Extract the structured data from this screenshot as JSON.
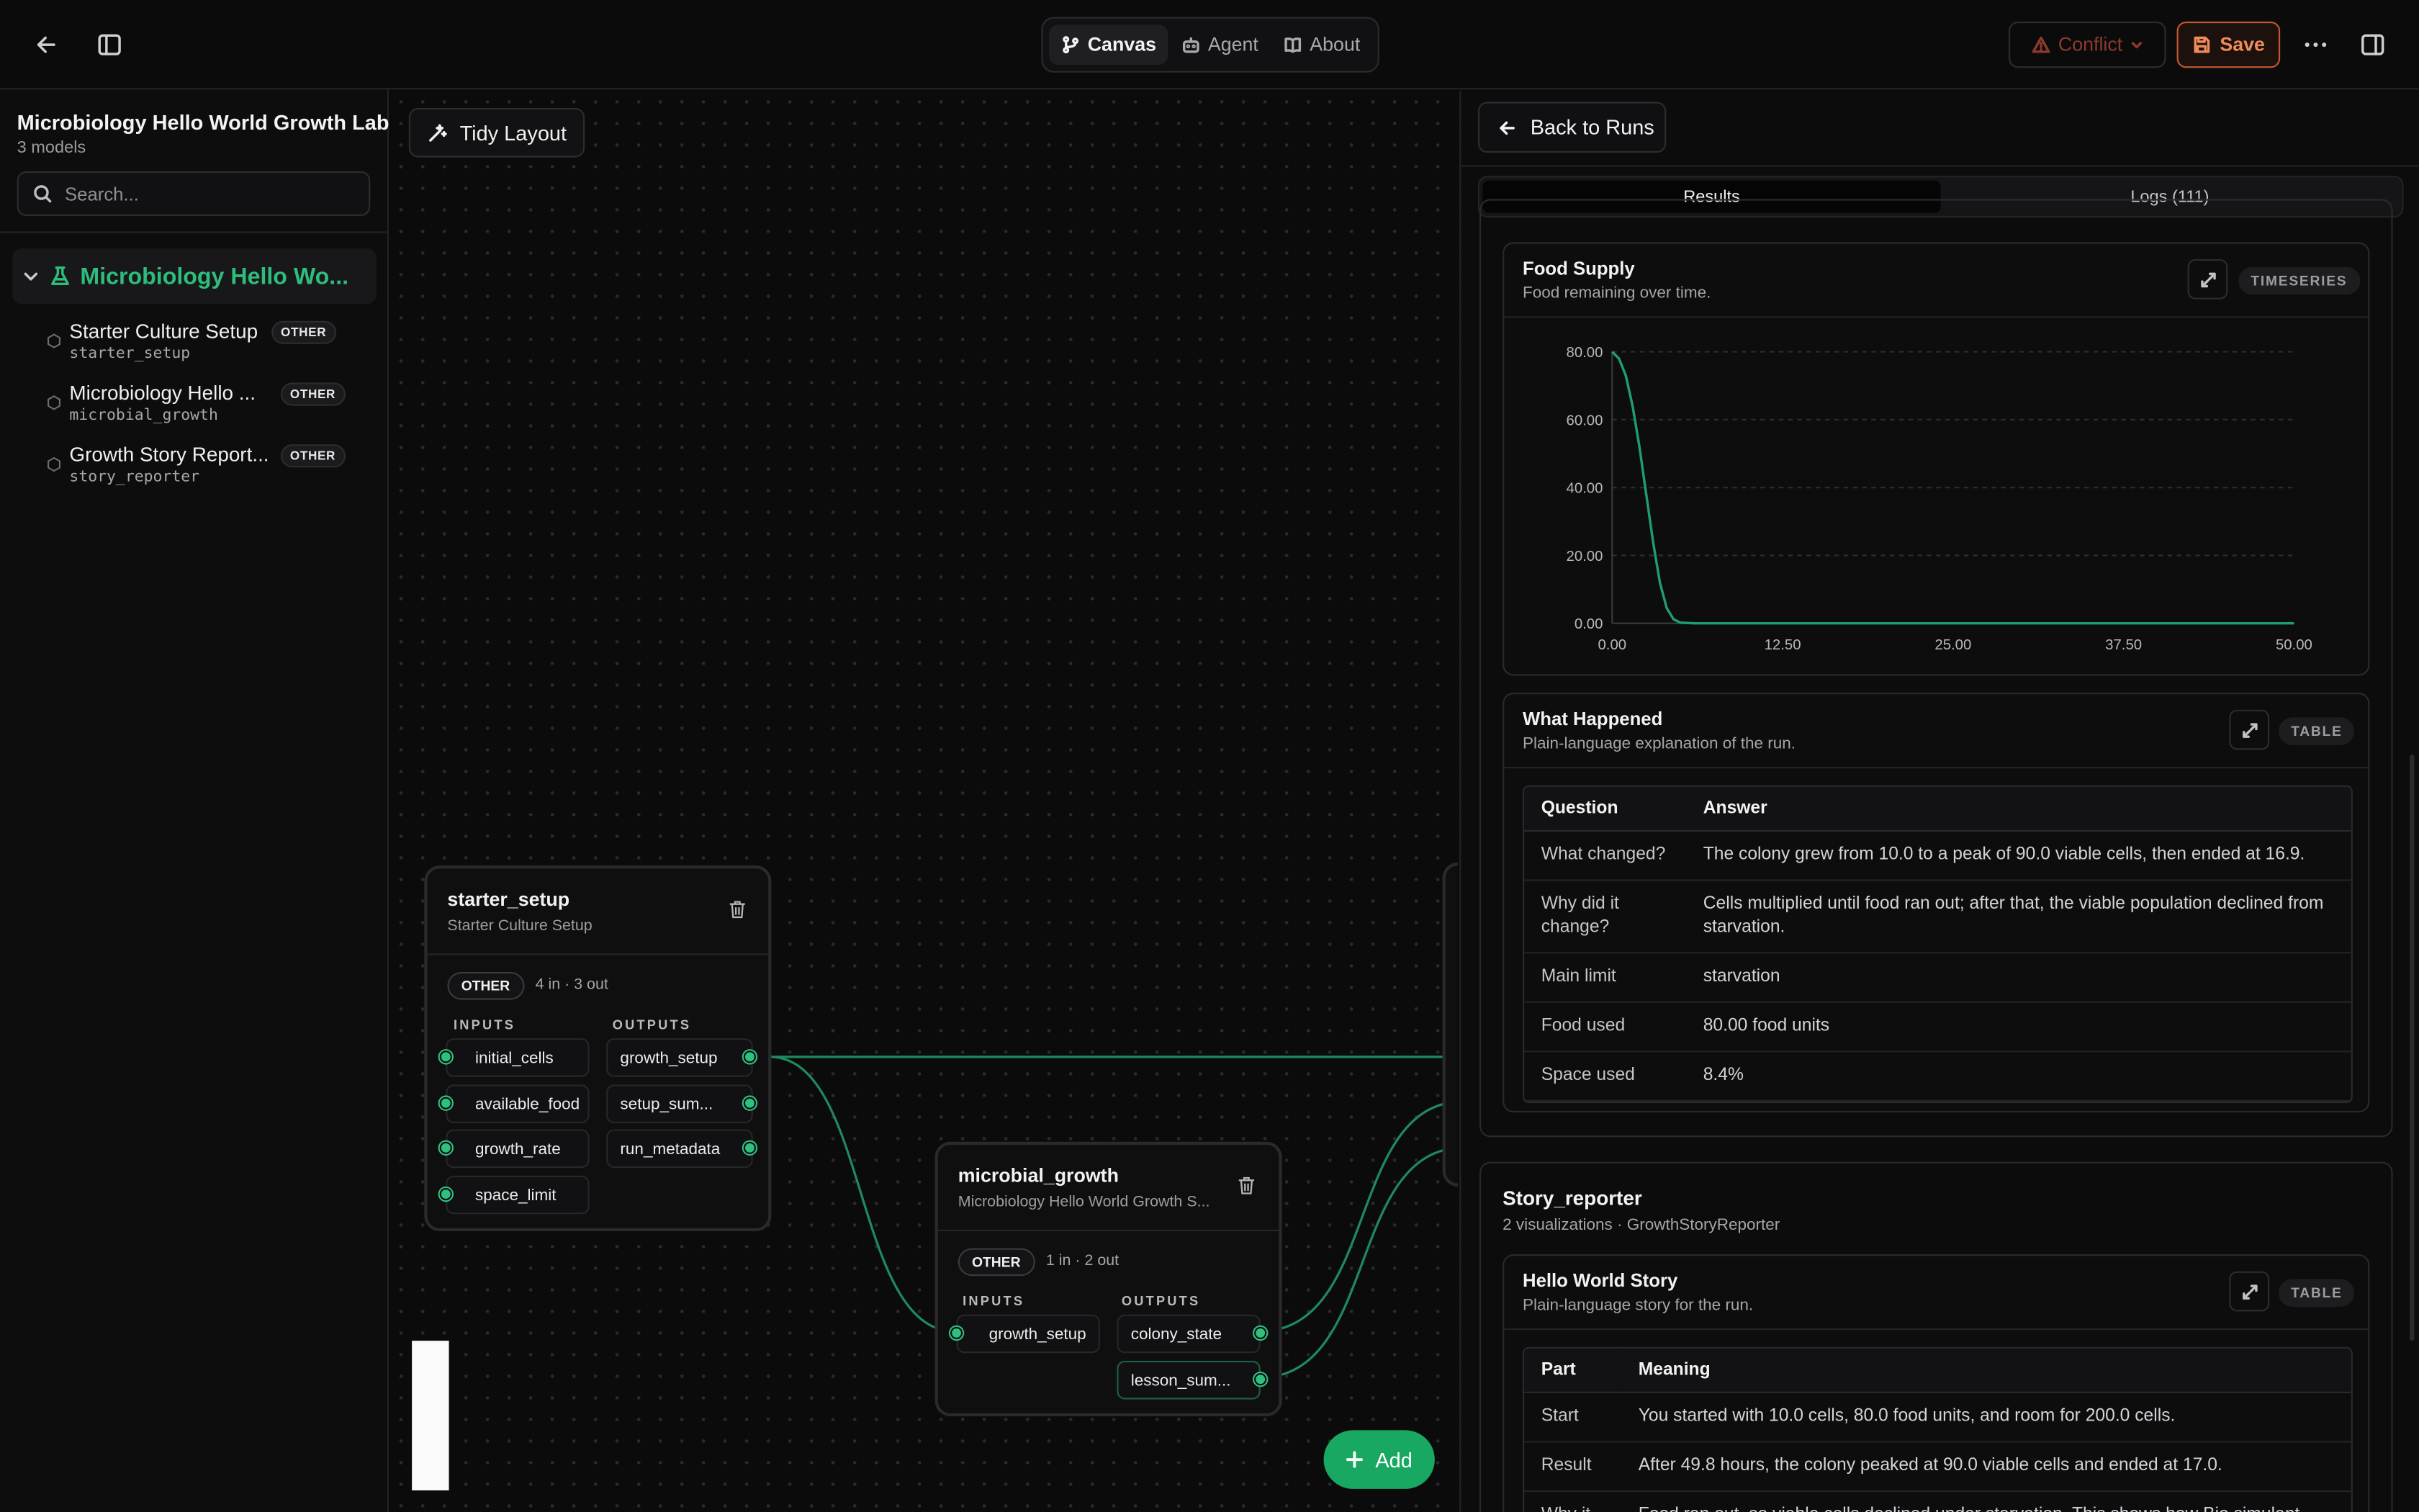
{
  "topbar": {
    "tabs": [
      {
        "label": "Canvas",
        "active": true
      },
      {
        "label": "Agent",
        "active": false
      },
      {
        "label": "About",
        "active": false
      }
    ],
    "conflict_label": "Conflict",
    "save_label": "Save",
    "colors": {
      "accent": "#2dbd7c",
      "save": "#f08c5a",
      "conflict": "#8c3a2e"
    }
  },
  "sidebar": {
    "title": "Microbiology Hello World Growth Lab",
    "subtitle": "3 models",
    "search_placeholder": "Search...",
    "root_label": "Microbiology Hello Wo...",
    "items": [
      {
        "name": "Starter Culture Setup",
        "id": "starter_setup",
        "tag": "OTHER"
      },
      {
        "name": "Microbiology Hello ...",
        "id": "microbial_growth",
        "tag": "OTHER"
      },
      {
        "name": "Growth Story Report...",
        "id": "story_reporter",
        "tag": "OTHER"
      }
    ]
  },
  "canvas": {
    "tidy_label": "Tidy Layout",
    "add_label": "Add",
    "nodes": [
      {
        "title": "starter_setup",
        "subtitle": "Starter Culture Setup",
        "tag": "OTHER",
        "count": "4 in · 3 out",
        "inputs_label": "INPUTS",
        "outputs_label": "OUTPUTS",
        "inputs": [
          "initial_cells",
          "available_food",
          "growth_rate",
          "space_limit"
        ],
        "outputs": [
          "growth_setup",
          "setup_sum...",
          "run_metadata"
        ]
      },
      {
        "title": "microbial_growth",
        "subtitle": "Microbiology Hello World Growth S...",
        "tag": "OTHER",
        "count": "1 in · 2 out",
        "inputs_label": "INPUTS",
        "outputs_label": "OUTPUTS",
        "inputs": [
          "growth_setup"
        ],
        "outputs": [
          "colony_state",
          "lesson_sum..."
        ]
      }
    ]
  },
  "panel": {
    "back_label": "Back to Runs",
    "tabs": [
      {
        "label": "Results",
        "active": true
      },
      {
        "label": "Logs (111)",
        "active": false
      }
    ],
    "food_card": {
      "title": "Food Supply",
      "description": "Food remaining over time.",
      "type_tag": "TIMESERIES"
    },
    "what_card": {
      "title": "What Happened",
      "description": "Plain-language explanation of the run.",
      "type_tag": "TABLE",
      "headers": [
        "Question",
        "Answer"
      ],
      "rows": [
        [
          "What changed?",
          "The colony grew from 10.0 to a peak of 90.0 viable cells, then ended at 16.9."
        ],
        [
          "Why did it change?",
          "Cells multiplied until food ran out; after that, the viable population declined from starvation."
        ],
        [
          "Main limit",
          "starvation"
        ],
        [
          "Food used",
          "80.00 food units"
        ],
        [
          "Space used",
          "8.4%"
        ]
      ]
    },
    "story_section": {
      "title": "Story_reporter",
      "subtitle": "2 visualizations · GrowthStoryReporter"
    },
    "story_card": {
      "title": "Hello World Story",
      "description": "Plain-language story for the run.",
      "type_tag": "TABLE",
      "headers": [
        "Part",
        "Meaning"
      ],
      "rows": [
        [
          "Start",
          "You started with 10.0 cells, 80.0 food units, and room for 200.0 cells."
        ],
        [
          "Result",
          "After 49.8 hours, the colony peaked at 90.0 viable cells and ended at 17.0."
        ],
        [
          "Why it",
          "Food ran out, so viable cells declined under starvation. This shows how Bio simulant..."
        ]
      ]
    }
  },
  "chart_data": {
    "type": "line",
    "title": "Food Supply",
    "xlabel": "",
    "ylabel": "",
    "xlim": [
      0,
      50
    ],
    "ylim": [
      0,
      80
    ],
    "x_ticks": [
      "0.00",
      "12.50",
      "25.00",
      "37.50",
      "50.00"
    ],
    "y_ticks": [
      "0.00",
      "20.00",
      "40.00",
      "60.00",
      "80.00"
    ],
    "grid": true,
    "line_color": "#1f9e6b",
    "series": [
      {
        "x": [
          0,
          0.5,
          1,
          1.5,
          2,
          2.5,
          3,
          3.5,
          4,
          4.5,
          5,
          6,
          8,
          12.5,
          25,
          37.5,
          50
        ],
        "values": [
          80,
          78,
          73,
          64,
          52,
          38,
          24,
          12,
          4.5,
          1.2,
          0.2,
          0,
          0,
          0,
          0,
          0,
          0
        ]
      }
    ]
  }
}
